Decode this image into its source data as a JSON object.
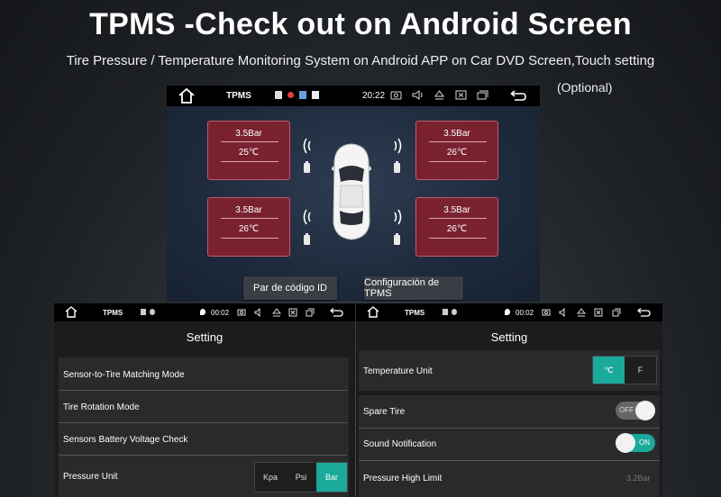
{
  "headline": "TPMS -Check out on Android Screen",
  "subline": "Tire Pressure / Temperature Monitoring System on Android APP on Car DVD Screen,Touch setting",
  "optional": "(Optional)",
  "main_screen": {
    "app_name": "TPMS",
    "time": "20:22",
    "tires": [
      {
        "pressure": "3.5Bar",
        "temp": "25℃"
      },
      {
        "pressure": "3.5Bar",
        "temp": "26℃"
      },
      {
        "pressure": "3.5Bar",
        "temp": "26℃"
      },
      {
        "pressure": "3.5Bar",
        "temp": "26℃"
      }
    ],
    "button_id": "Par de código ID",
    "button_config": "Configuración de TPMS",
    "tire_color": "#7a2130"
  },
  "settings_left": {
    "app_name": "TPMS",
    "time": "00:02",
    "title": "Setting",
    "rows": [
      "Sensor-to-Tire Matching Mode",
      "Tire Rotation Mode",
      "Sensors Battery Voltage Check",
      "Pressure Unit"
    ],
    "pressure_units": [
      "Kpa",
      "Psi",
      "Bar"
    ],
    "selected_unit": "Bar"
  },
  "settings_right": {
    "app_name": "TPMS",
    "time": "00:02",
    "title": "Setting",
    "temp_label": "Temperature Unit",
    "temp_units": [
      "℃",
      "F"
    ],
    "spare_label": "Spare Tire",
    "spare_state": "OFF",
    "sound_label": "Sound Notification",
    "sound_state": "ON",
    "high_limit_label": "Pressure High Limit",
    "high_limit_value": "3.2Bar",
    "accent": "#1aa99a"
  }
}
